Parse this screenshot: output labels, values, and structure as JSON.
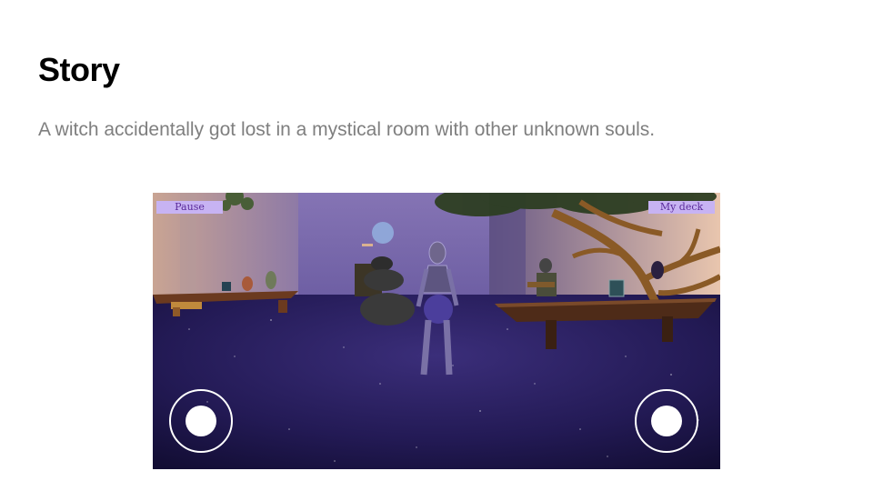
{
  "slide": {
    "title": "Story",
    "subtitle": "A witch accidentally got lost in a mystical room with other unknown souls."
  },
  "game": {
    "hud": {
      "pause_label": "Pause",
      "deck_label": "My deck"
    },
    "colors": {
      "hud_button_bg": "#c7b3f3",
      "hud_button_text": "#5a2a9a",
      "floor": "#1d1745",
      "wall_left": "#a98fa6",
      "wall_back": "#8f7fb7"
    }
  }
}
